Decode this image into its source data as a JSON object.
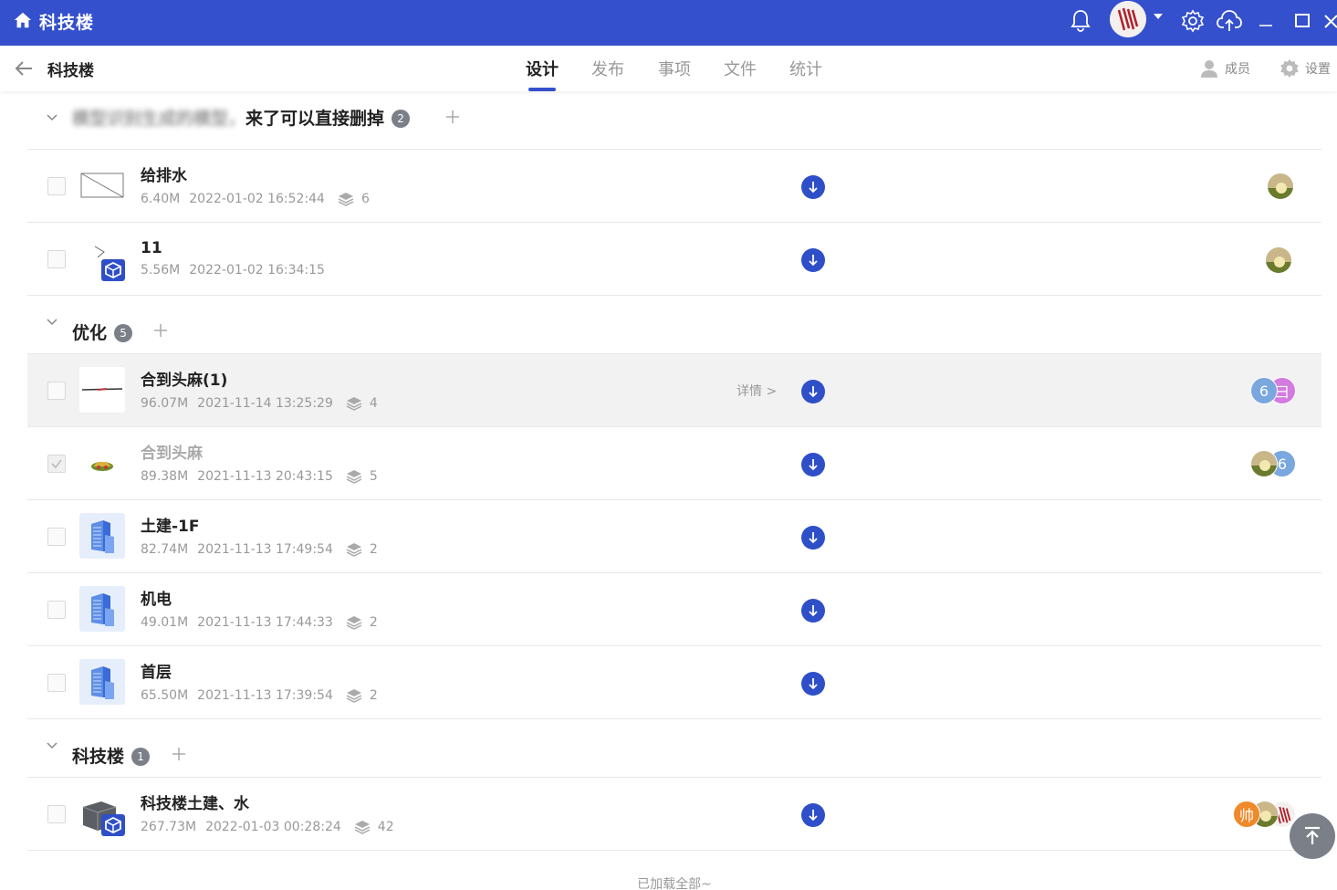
{
  "app": {
    "title": "科技楼"
  },
  "header": {
    "project_name": "科技楼",
    "tabs": [
      {
        "label": "设计",
        "active": true
      },
      {
        "label": "发布",
        "active": false
      },
      {
        "label": "事项",
        "active": false
      },
      {
        "label": "文件",
        "active": false
      },
      {
        "label": "统计",
        "active": false
      }
    ],
    "members_label": "成员",
    "settings_label": "设置"
  },
  "groups": [
    {
      "title_hidden": "模型识别生成的模型，",
      "title_tail": "来了可以直接删掉",
      "count": "2",
      "files": [
        {
          "name": "给排水",
          "size": "6.40M",
          "date": "2022-01-02 16:52:44",
          "layers": "6",
          "thumb": "sketch",
          "members": [
            "landscape"
          ]
        },
        {
          "name": "11",
          "size": "5.56M",
          "date": "2022-01-02 16:34:15",
          "layers": "",
          "thumb": "sketch-badge",
          "members": [
            "landscape"
          ]
        }
      ]
    },
    {
      "title": "优化",
      "count": "5",
      "files": [
        {
          "name": "合到头麻(1)",
          "size": "96.07M",
          "date": "2021-11-14 13:25:29",
          "layers": "4",
          "thumb": "line",
          "details": "详情 >",
          "members": [
            "6",
            "彐"
          ]
        },
        {
          "name": "合到头麻",
          "size": "89.38M",
          "date": "2021-11-13 20:43:15",
          "layers": "5",
          "thumb": "model",
          "checked": true,
          "members": [
            "landscape",
            "6"
          ]
        },
        {
          "name": "土建-1F",
          "size": "82.74M",
          "date": "2021-11-13 17:49:54",
          "layers": "2",
          "thumb": "building"
        },
        {
          "name": "机电",
          "size": "49.01M",
          "date": "2021-11-13 17:44:33",
          "layers": "2",
          "thumb": "building"
        },
        {
          "name": "首层",
          "size": "65.50M",
          "date": "2021-11-13 17:39:54",
          "layers": "2",
          "thumb": "building"
        }
      ]
    },
    {
      "title": "科技楼",
      "count": "1",
      "files": [
        {
          "name": "科技楼土建、水",
          "size": "267.73M",
          "date": "2022-01-03 00:28:24",
          "layers": "42",
          "thumb": "dark-model",
          "members": [
            "帅",
            "landscape",
            "logo"
          ]
        }
      ]
    }
  ],
  "footer": {
    "loaded_all": "已加载全部~"
  },
  "colors": {
    "brand": "#3450cc",
    "download": "#2f4fc9",
    "badge": "#7a7f88"
  }
}
